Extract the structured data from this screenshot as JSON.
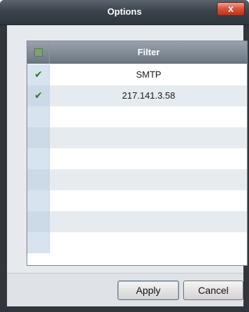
{
  "window": {
    "title": "Options",
    "close_label": "x"
  },
  "table": {
    "header": {
      "filter_label": "Filter",
      "select_all_checked": true
    },
    "rows": [
      {
        "checked": true,
        "value": "SMTP"
      },
      {
        "checked": true,
        "value": "217.141.3.58"
      },
      {
        "checked": false,
        "value": ""
      },
      {
        "checked": false,
        "value": ""
      },
      {
        "checked": false,
        "value": ""
      },
      {
        "checked": false,
        "value": ""
      },
      {
        "checked": false,
        "value": ""
      },
      {
        "checked": false,
        "value": ""
      },
      {
        "checked": false,
        "value": ""
      }
    ]
  },
  "footer": {
    "apply_label": "Apply",
    "cancel_label": "Cancel"
  },
  "icons": {
    "check": "checkmark-icon",
    "close": "close-icon"
  }
}
